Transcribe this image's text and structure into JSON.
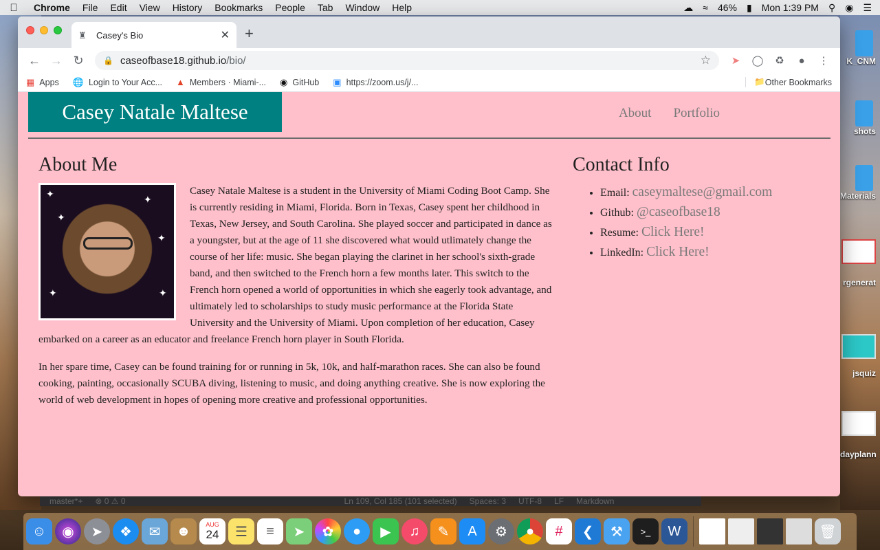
{
  "menubar": {
    "app_name": "Chrome",
    "menus": [
      "File",
      "Edit",
      "View",
      "History",
      "Bookmarks",
      "People",
      "Tab",
      "Window",
      "Help"
    ],
    "battery": "46%",
    "clock": "Mon 1:39 PM"
  },
  "browser": {
    "tab_title": "Casey's Bio",
    "url_host": "caseofbase18.github.io",
    "url_path": "/bio/",
    "bookmarks": [
      {
        "label": "Apps",
        "icon": "apps-grid-icon"
      },
      {
        "label": "Login to Your Acc...",
        "icon": "globe-icon"
      },
      {
        "label": "Members · Miami-...",
        "icon": "gitlab-icon"
      },
      {
        "label": "GitHub",
        "icon": "github-icon"
      },
      {
        "label": "https://zoom.us/j/...",
        "icon": "zoom-icon"
      }
    ],
    "other_bookmarks": "Other Bookmarks"
  },
  "site": {
    "brand": "Casey Natale Maltese",
    "nav": [
      "About",
      "Portfolio"
    ],
    "about": {
      "heading": "About Me",
      "paragraph1": "Casey Natale Maltese is a student in the University of Miami Coding Boot Camp. She is currently residing in Miami, Florida. Born in Texas, Casey spent her childhood in Texas, New Jersey, and South Carolina. She played soccer and participated in dance as a youngster, but at the age of 11 she discovered what would utlimately change the course of her life: music. She began playing the clarinet in her school's sixth-grade band, and then switched to the French horn a few months later. This switch to the French horn opened a world of opportunities in which she eagerly took advantage, and ultimately led to scholarships to study music performance at the Florida State University and the University of Miami. Upon completion of her education, Casey embarked on a career as an educator and freelance French horn player in South Florida.",
      "paragraph2": "In her spare time, Casey can be found training for or running in 5k, 10k, and half-marathon races. She can also be found cooking, painting, occasionally SCUBA diving, listening to music, and doing anything creative. She is now exploring the world of web development in hopes of opening more creative and professional opportunities."
    },
    "contact": {
      "heading": "Contact Info",
      "items": [
        {
          "label": "Email:",
          "link": "caseymaltese@gmail.com"
        },
        {
          "label": "Github:",
          "link": "@caseofbase18"
        },
        {
          "label": "Resume:",
          "link": "Click Here!"
        },
        {
          "label": "LinkedIn:",
          "link": "Click Here!"
        }
      ]
    }
  },
  "editor_status": {
    "branch": "master*+",
    "errors": "⊗ 0 ⚠ 0",
    "position": "Ln 109, Col 185 (101 selected)",
    "spaces": "Spaces: 3",
    "encoding": "UTF-8",
    "eol": "LF",
    "language": "Markdown"
  },
  "desktop": {
    "labels": [
      "K_CNM",
      "shots",
      "Materials",
      "rgenerat",
      "jsquiz",
      "dayplanne"
    ]
  },
  "dock": {
    "calendar_month": "AUG",
    "calendar_day": "24"
  },
  "colors": {
    "page_bg": "#ffc0cb",
    "brand_bg": "#008080",
    "link": "#7a7a7a"
  }
}
